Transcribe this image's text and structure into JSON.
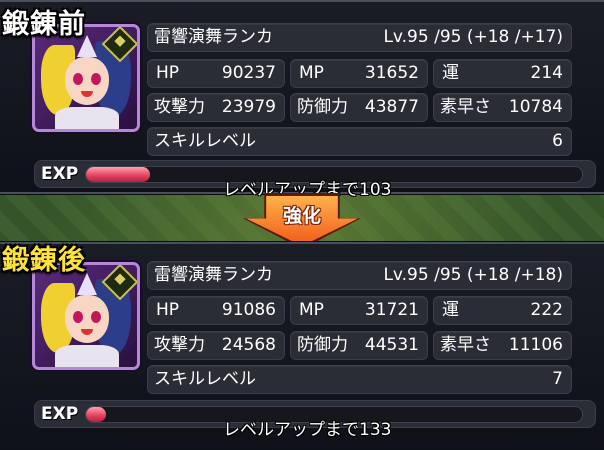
{
  "before": {
    "title": "鍛錬前",
    "name": "雷響演舞ランカ",
    "level": "Lv.95 /95 (+18 /+17)",
    "hp_label": "HP",
    "hp": "90237",
    "mp_label": "MP",
    "mp": "31652",
    "luck_label": "運",
    "luck": "214",
    "attack_label": "攻撃力",
    "attack": "23979",
    "defense_label": "防御力",
    "defense": "43877",
    "speed_label": "素早さ",
    "speed": "10784",
    "skill_label": "スキルレベル",
    "skill": "6",
    "exp_label": "EXP",
    "exp_progress": 0.13,
    "levelup": "レベルアップまで103"
  },
  "enhance_label": "強化",
  "after": {
    "title": "鍛錬後",
    "name": "雷響演舞ランカ",
    "level": "Lv.95 /95 (+18 /+18)",
    "hp_label": "HP",
    "hp": "91086",
    "mp_label": "MP",
    "mp": "31721",
    "luck_label": "運",
    "luck": "222",
    "attack_label": "攻撃力",
    "attack": "24568",
    "defense_label": "防御力",
    "defense": "44531",
    "speed_label": "素早さ",
    "speed": "11106",
    "skill_label": "スキルレベル",
    "skill": "7",
    "exp_label": "EXP",
    "exp_progress": 0.04,
    "levelup": "レベルアップまで133"
  },
  "colors": {
    "after_title": "#ffe23a",
    "exp_fill": "#e0405a",
    "enhance_arrow": "#f05a1a"
  }
}
